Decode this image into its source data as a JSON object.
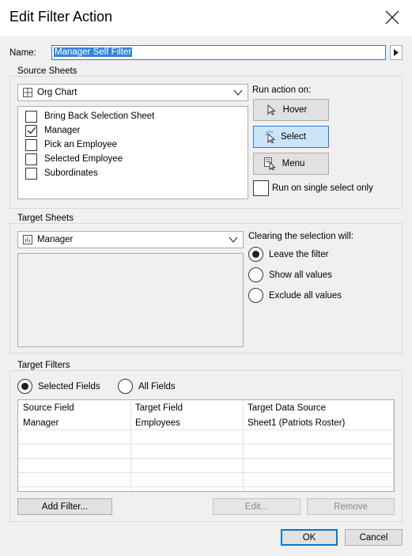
{
  "window": {
    "title": "Edit Filter Action"
  },
  "name": {
    "label": "Name:",
    "value": "Manager Self Filter"
  },
  "source_sheets": {
    "group_title": "Source Sheets",
    "dropdown_value": "Org Chart",
    "sheets": [
      {
        "label": "Bring Back Selection Sheet",
        "checked": false
      },
      {
        "label": "Manager",
        "checked": true
      },
      {
        "label": "Pick an Employee",
        "checked": false
      },
      {
        "label": "Selected Employee",
        "checked": false
      },
      {
        "label": "Subordinates",
        "checked": false
      }
    ],
    "run_action_label": "Run action on:",
    "run_buttons": {
      "hover": "Hover",
      "select": "Select",
      "menu": "Menu"
    },
    "selected_run": "select",
    "single_select_label": "Run on single select only",
    "single_select_checked": false
  },
  "target_sheets": {
    "group_title": "Target Sheets",
    "dropdown_value": "Manager",
    "clearing_label": "Clearing the selection will:",
    "options": [
      "Leave the filter",
      "Show all values",
      "Exclude all values"
    ],
    "selected_option": 0
  },
  "target_filters": {
    "group_title": "Target Filters",
    "scope_options": [
      "Selected Fields",
      "All Fields"
    ],
    "selected_scope": 0,
    "columns": [
      "Source Field",
      "Target Field",
      "Target Data Source"
    ],
    "rows": [
      [
        "Manager",
        "Employees",
        "Sheet1 (Patriots Roster)"
      ]
    ],
    "buttons": {
      "add": "Add Filter...",
      "edit": "Edit...",
      "remove": "Remove"
    }
  },
  "footer": {
    "ok": "OK",
    "cancel": "Cancel"
  }
}
